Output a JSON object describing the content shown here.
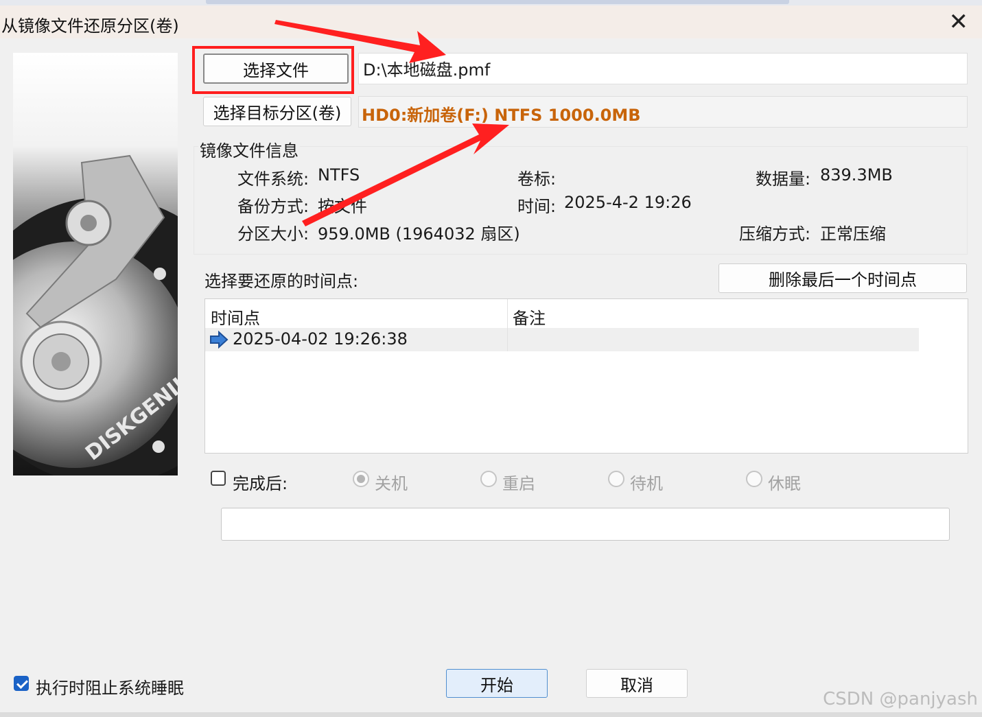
{
  "window": {
    "title": "从镜像文件还原分区(卷)"
  },
  "source": {
    "button_label": "选择文件",
    "path": "D:\\本地磁盘.pmf"
  },
  "target": {
    "button_label": "选择目标分区(卷)",
    "value": "HD0:新加卷(F:) NTFS 1000.0MB"
  },
  "image_info": {
    "group_label": "镜像文件信息",
    "filesystem_label": "文件系统:",
    "filesystem": "NTFS",
    "volume_label_label": "卷标:",
    "volume_label": "",
    "data_size_label": "数据量:",
    "data_size": "839.3MB",
    "backup_mode_label": "备份方式:",
    "backup_mode": "按文件",
    "time_label": "时间:",
    "time": "2025-4-2 19:26",
    "partition_size_label": "分区大小:",
    "partition_size": "959.0MB  (1964032 扇区)",
    "compression_label": "压缩方式:",
    "compression": "正常压缩"
  },
  "timepoints": {
    "label": "选择要还原的时间点:",
    "delete_button": "删除最后一个时间点",
    "columns": [
      "时间点",
      "备注"
    ],
    "rows": [
      {
        "time": "2025-04-02 19:26:38",
        "note": ""
      }
    ]
  },
  "after_completion": {
    "label": "完成后:",
    "checked": false,
    "options": [
      "关机",
      "重启",
      "待机",
      "休眠"
    ],
    "selected": "关机"
  },
  "progress": {
    "value": 0
  },
  "prevent_sleep": {
    "label": "执行时阻止系统睡眠",
    "checked": true
  },
  "actions": {
    "start": "开始",
    "cancel": "取消"
  },
  "image_caption": {
    "brand": "DISKGENIUS"
  },
  "watermark": "CSDN @panjyash",
  "colors": {
    "target_text": "#c8640a",
    "highlight": "#ff1e1e",
    "checkbox": "#1a62c6"
  }
}
